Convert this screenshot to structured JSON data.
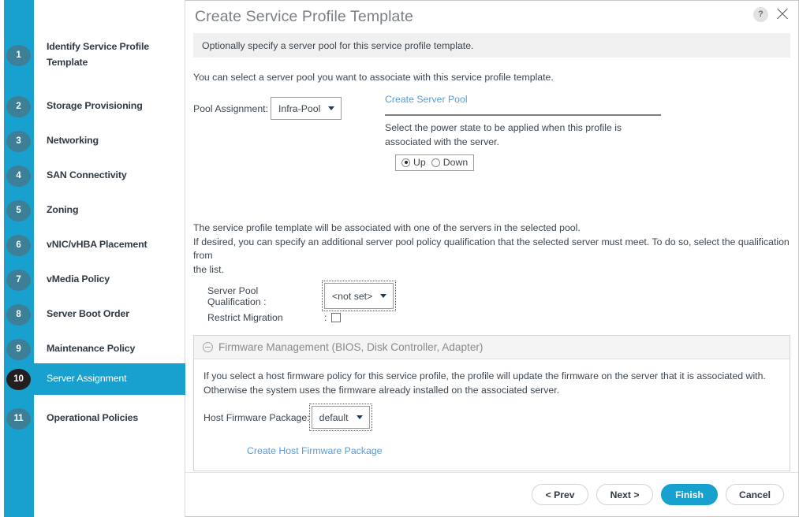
{
  "window": {
    "title": "Create Service Profile Template",
    "help_icon": "?",
    "help_icon_name": "help-icon",
    "close_icon_name": "close-icon",
    "subtitle": "Optionally specify a server pool for this service profile template."
  },
  "wizard": {
    "steps": [
      {
        "number": "1",
        "label": "Identify Service Profile Template",
        "active": false
      },
      {
        "number": "2",
        "label": "Storage Provisioning",
        "active": false
      },
      {
        "number": "3",
        "label": "Networking",
        "active": false
      },
      {
        "number": "4",
        "label": "SAN Connectivity",
        "active": false
      },
      {
        "number": "5",
        "label": "Zoning",
        "active": false
      },
      {
        "number": "6",
        "label": "vNIC/vHBA Placement",
        "active": false
      },
      {
        "number": "7",
        "label": "vMedia Policy",
        "active": false
      },
      {
        "number": "8",
        "label": "Server Boot Order",
        "active": false
      },
      {
        "number": "9",
        "label": "Maintenance Policy",
        "active": false
      },
      {
        "number": "10",
        "label": "Server Assignment",
        "active": true
      },
      {
        "number": "11",
        "label": "Operational Policies",
        "active": false
      }
    ]
  },
  "main": {
    "intro": "You can select a server pool you want to associate with this service profile template.",
    "pool_assignment_label": "Pool Assignment:",
    "pool_assignment_value": "Infra-Pool",
    "create_server_pool_link": "Create Server Pool",
    "power_state_text": "Select the power state to be applied when this profile is associated with the server.",
    "power_state_options": [
      {
        "label": "Up",
        "selected": true
      },
      {
        "label": "Down",
        "selected": false
      }
    ],
    "assoc_line1": "The service profile template will be associated with one of the servers in the selected pool.",
    "assoc_line2": "If desired, you can specify an additional server pool policy qualification that the selected server must meet. To do so, select the qualification from",
    "assoc_line3": "the list.",
    "qualification_label": "Server Pool Qualification :",
    "qualification_value": "<not set>",
    "restrict_migration_label": "Restrict Migration",
    "restrict_migration_colon": ":",
    "restrict_migration_checked": false
  },
  "firmware": {
    "section_title": "Firmware Management (BIOS, Disk Controller, Adapter)",
    "collapse_icon_name": "minus-circle-icon",
    "desc_line1": "If you select a host firmware policy for this service profile, the profile will update the firmware on the server that it is associated with.",
    "desc_line2": "Otherwise the system uses the firmware already installed on the associated server.",
    "host_fw_label": "Host Firmware Package:",
    "host_fw_value": "default",
    "create_host_fw_link": "Create Host Firmware Package"
  },
  "footer": {
    "prev": "< Prev",
    "next": "Next >",
    "finish": "Finish",
    "cancel": "Cancel"
  },
  "colors": {
    "accent": "#18a0cf",
    "bubble": "#3c7f96",
    "bubble_active": "#231f20",
    "link": "#5b9bd5",
    "text": "#3c4650"
  }
}
